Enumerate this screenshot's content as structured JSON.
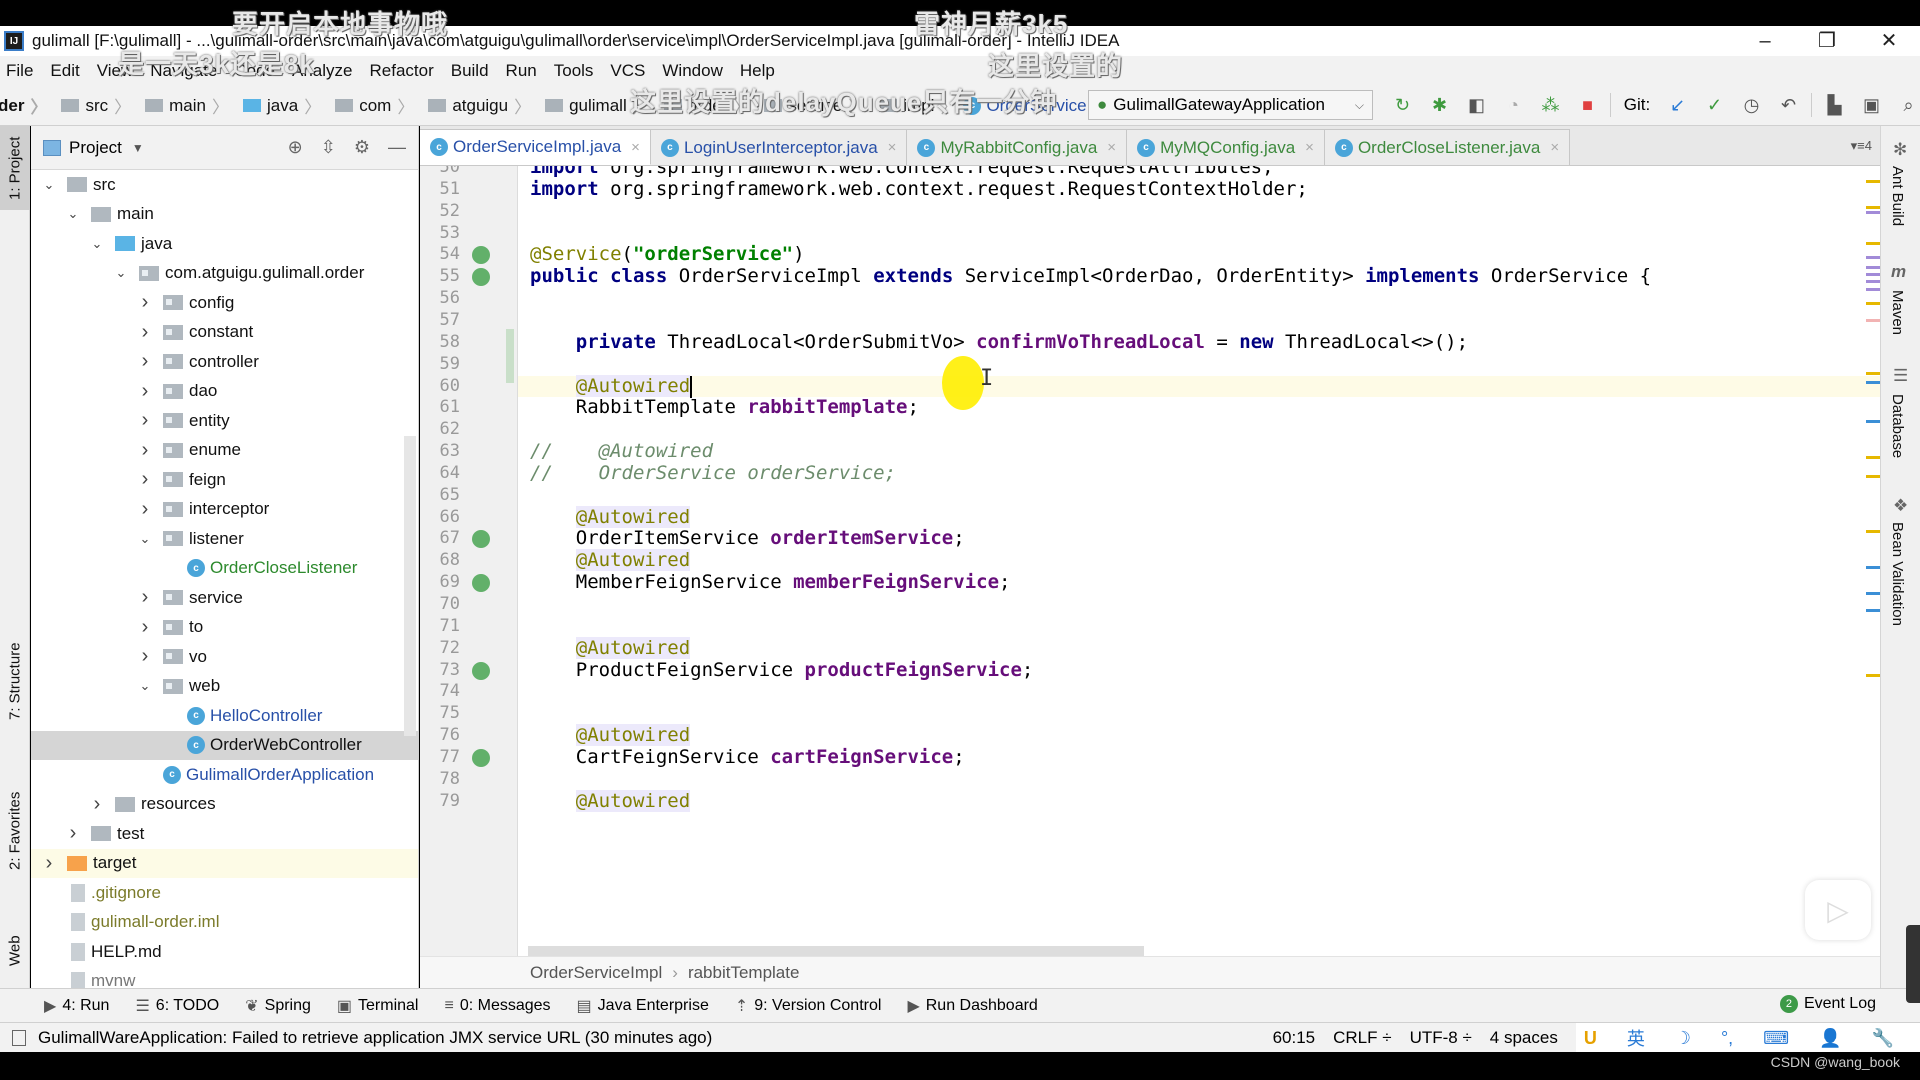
{
  "window": {
    "title": "gulimall [F:\\gulimall] - ...\\gulimall-order\\src\\main\\java\\com\\atguigu\\gulimall\\order\\service\\impl\\OrderServiceImpl.java [gulimall-order] - IntelliJ IDEA",
    "logo": "IJ",
    "controls": [
      "–",
      "❐",
      "✕"
    ]
  },
  "menu": [
    "File",
    "Edit",
    "View",
    "Navigate",
    "Code",
    "Analyze",
    "Refactor",
    "Build",
    "Run",
    "Tools",
    "VCS",
    "Window",
    "Help"
  ],
  "navbar": {
    "breadcrumb": [
      "der",
      "src",
      "main",
      "java",
      "com",
      "atguigu",
      "gulimall",
      "order",
      "service",
      "impl",
      "OrderServiceImpl"
    ],
    "run_config": "GulimallGatewayApplication",
    "git_label": "Git:",
    "toolbar_icons": [
      "rerun-icon",
      "debug-icon",
      "coverage-icon",
      "profile-icon",
      "build-icon",
      "stop-icon"
    ],
    "git_icons": [
      "update-icon",
      "commit-icon",
      "history-icon",
      "rollback-icon"
    ],
    "right_icons": [
      "project-structure-icon",
      "terminal-icon",
      "search-icon"
    ]
  },
  "left_strip": {
    "tabs": [
      "1: Project",
      "7: Structure",
      "2: Favorites",
      "Web"
    ]
  },
  "project_panel": {
    "title": "Project",
    "tree": [
      {
        "label": "src",
        "depth": 0,
        "arrow": "open",
        "icon": "folder"
      },
      {
        "label": "main",
        "depth": 1,
        "arrow": "open",
        "icon": "folder"
      },
      {
        "label": "java",
        "depth": 2,
        "arrow": "open",
        "icon": "folder-blue"
      },
      {
        "label": "com.atguigu.gulimall.order",
        "depth": 3,
        "arrow": "open",
        "icon": "package"
      },
      {
        "label": "config",
        "depth": 4,
        "arrow": "closed",
        "icon": "package"
      },
      {
        "label": "constant",
        "depth": 4,
        "arrow": "closed",
        "icon": "package"
      },
      {
        "label": "controller",
        "depth": 4,
        "arrow": "closed",
        "icon": "package"
      },
      {
        "label": "dao",
        "depth": 4,
        "arrow": "closed",
        "icon": "package"
      },
      {
        "label": "entity",
        "depth": 4,
        "arrow": "closed",
        "icon": "package"
      },
      {
        "label": "enume",
        "depth": 4,
        "arrow": "closed",
        "icon": "package"
      },
      {
        "label": "feign",
        "depth": 4,
        "arrow": "closed",
        "icon": "package"
      },
      {
        "label": "interceptor",
        "depth": 4,
        "arrow": "closed",
        "icon": "package"
      },
      {
        "label": "listener",
        "depth": 4,
        "arrow": "open",
        "icon": "package"
      },
      {
        "label": "OrderCloseListener",
        "depth": 5,
        "arrow": "none",
        "icon": "class",
        "color": "green"
      },
      {
        "label": "service",
        "depth": 4,
        "arrow": "closed",
        "icon": "package"
      },
      {
        "label": "to",
        "depth": 4,
        "arrow": "closed",
        "icon": "package"
      },
      {
        "label": "vo",
        "depth": 4,
        "arrow": "closed",
        "icon": "package"
      },
      {
        "label": "web",
        "depth": 4,
        "arrow": "open",
        "icon": "package"
      },
      {
        "label": "HelloController",
        "depth": 5,
        "arrow": "none",
        "icon": "class",
        "color": "blue"
      },
      {
        "label": "OrderWebController",
        "depth": 5,
        "arrow": "none",
        "icon": "class",
        "selected": true
      },
      {
        "label": "GulimallOrderApplication",
        "depth": 4,
        "arrow": "none",
        "icon": "spring-class",
        "color": "blue"
      },
      {
        "label": "resources",
        "depth": 2,
        "arrow": "closed",
        "icon": "resources"
      },
      {
        "label": "test",
        "depth": 1,
        "arrow": "closed",
        "icon": "folder"
      },
      {
        "label": "target",
        "depth": 0,
        "arrow": "closed",
        "icon": "folder-orange",
        "highlight": true
      },
      {
        "label": ".gitignore",
        "depth": 0,
        "arrow": "none",
        "icon": "file",
        "color": "olive"
      },
      {
        "label": "gulimall-order.iml",
        "depth": 0,
        "arrow": "none",
        "icon": "file",
        "color": "olive"
      },
      {
        "label": "HELP.md",
        "depth": 0,
        "arrow": "none",
        "icon": "md-file"
      },
      {
        "label": "mvnw",
        "depth": 0,
        "arrow": "none",
        "icon": "file",
        "color": "muted"
      }
    ]
  },
  "editor_tabs": [
    {
      "label": "OrderServiceImpl.java",
      "active": true
    },
    {
      "label": "LoginUserInterceptor.java"
    },
    {
      "label": "MyRabbitConfig.java",
      "green": true
    },
    {
      "label": "MyMQConfig.java",
      "green": true
    },
    {
      "label": "OrderCloseListener.java",
      "green": true
    }
  ],
  "tabs_more": "▾≡4",
  "code_lines": [
    {
      "n": 50,
      "html": "<span class='kw'>import</span> org.springframework.web.context.request.RequestAttributes;"
    },
    {
      "n": 51,
      "html": "<span class='kw'>import</span> org.springframework.web.context.request.RequestContextHolder;"
    },
    {
      "n": 52,
      "html": ""
    },
    {
      "n": 53,
      "html": ""
    },
    {
      "n": 54,
      "html": "<span class='ann'>@Service</span>(<span class='str'>\"orderService\"</span>)",
      "gutter": true
    },
    {
      "n": 55,
      "html": "<span class='kw'>public class</span> OrderServiceImpl <span class='kw'>extends</span> ServiceImpl&lt;OrderDao, OrderEntity&gt; <span class='kw'>implements</span> OrderService {",
      "gutter": true
    },
    {
      "n": 56,
      "html": ""
    },
    {
      "n": 57,
      "html": ""
    },
    {
      "n": 58,
      "html": "    <span class='kw'>private</span> ThreadLocal&lt;OrderSubmitVo&gt; <span class='field'>confirmVoThreadLocal</span> = <span class='kw'>new</span> ThreadLocal&lt;&gt;();"
    },
    {
      "n": 59,
      "html": ""
    },
    {
      "n": 60,
      "html": "    <span class='ann ann-bg'>@Autowired</span><span class='caret'></span>",
      "current": true
    },
    {
      "n": 61,
      "html": "    RabbitTemplate <span class='field'>rabbitTemplate</span>;"
    },
    {
      "n": 62,
      "html": ""
    },
    {
      "n": 63,
      "html": "<span class='comment'>//    @Autowired</span>"
    },
    {
      "n": 64,
      "html": "<span class='comment'>//    OrderService orderService;</span>"
    },
    {
      "n": 65,
      "html": ""
    },
    {
      "n": 66,
      "html": "    <span class='ann ann-bg'>@Autowired</span>"
    },
    {
      "n": 67,
      "html": "    OrderItemService <span class='field'>orderItemService</span>;",
      "gutter": true
    },
    {
      "n": 68,
      "html": "    <span class='ann ann-bg'>@Autowired</span>"
    },
    {
      "n": 69,
      "html": "    MemberFeignService <span class='field'>memberFeignService</span>;",
      "gutter": true
    },
    {
      "n": 70,
      "html": ""
    },
    {
      "n": 71,
      "html": ""
    },
    {
      "n": 72,
      "html": "    <span class='ann ann-bg'>@Autowired</span>"
    },
    {
      "n": 73,
      "html": "    ProductFeignService <span class='field'>productFeignService</span>;",
      "gutter": true
    },
    {
      "n": 74,
      "html": ""
    },
    {
      "n": 75,
      "html": ""
    },
    {
      "n": 76,
      "html": "    <span class='ann ann-bg'>@Autowired</span>"
    },
    {
      "n": 77,
      "html": "    CartFeignService <span class='field'>cartFeignService</span>;",
      "gutter": true
    },
    {
      "n": 78,
      "html": ""
    },
    {
      "n": 79,
      "html": "    <span class='ann ann-bg'>@Autowired</span>"
    }
  ],
  "editor_breadcrumb": [
    "OrderServiceImpl",
    "rabbitTemplate"
  ],
  "right_strip": {
    "tabs": [
      "Ant Build",
      "Maven",
      "Database",
      "Bean Validation"
    ]
  },
  "tool_windows": [
    {
      "icon": "▶",
      "label": "4: Run"
    },
    {
      "icon": "☰",
      "label": "6: TODO"
    },
    {
      "icon": "❦",
      "label": "Spring"
    },
    {
      "icon": "▣",
      "label": "Terminal"
    },
    {
      "icon": "≡",
      "label": "0: Messages"
    },
    {
      "icon": "▤",
      "label": "Java Enterprise"
    },
    {
      "icon": "⇡",
      "label": "9: Version Control"
    },
    {
      "icon": "▶",
      "label": "Run Dashboard"
    }
  ],
  "event_log": {
    "count": "2",
    "label": "Event Log"
  },
  "status": {
    "message": "GulimallWareApplication: Failed to retrieve application JMX service URL (30 minutes ago)",
    "position": "60:15",
    "line_sep": "CRLF ÷",
    "encoding": "UTF-8 ÷",
    "indent": "4 spaces",
    "ime": [
      "U",
      "英",
      "☽",
      "°,",
      "⌨",
      "👤",
      "🔧"
    ]
  },
  "overlay_subtitles": [
    "要开启本地事物哦",
    "雷神月薪3k5",
    "是一天3k还是8k",
    "这里设置的",
    "这里设置的delayQueue只有一分钟"
  ],
  "watermark": "CSDN @wang_book"
}
